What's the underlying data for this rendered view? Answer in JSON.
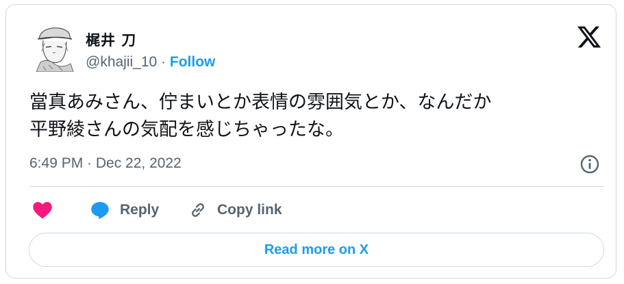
{
  "author": {
    "display_name": "梶井 刀",
    "handle": "@khajii_10",
    "separator": " · ",
    "follow_label": "Follow"
  },
  "tweet": {
    "lines": [
      "當真あみさん、佇まいとか表情の雰囲気とか、なんだか",
      "平野綾さんの気配を感じちゃったな。"
    ],
    "timestamp": "6:49 PM · Dec 22, 2022"
  },
  "actions": {
    "reply_label": "Reply",
    "copy_link_label": "Copy link",
    "read_more_label": "Read more on X"
  },
  "icons": {
    "logo": "x-logo-icon",
    "info": "info-icon",
    "like": "heart-icon",
    "reply": "speech-bubble-icon",
    "copy": "link-icon"
  },
  "colors": {
    "accent": "#1d9bf0",
    "heart": "#f91880",
    "text": "#0f1419",
    "muted": "#536471",
    "border": "#cfd9de"
  }
}
